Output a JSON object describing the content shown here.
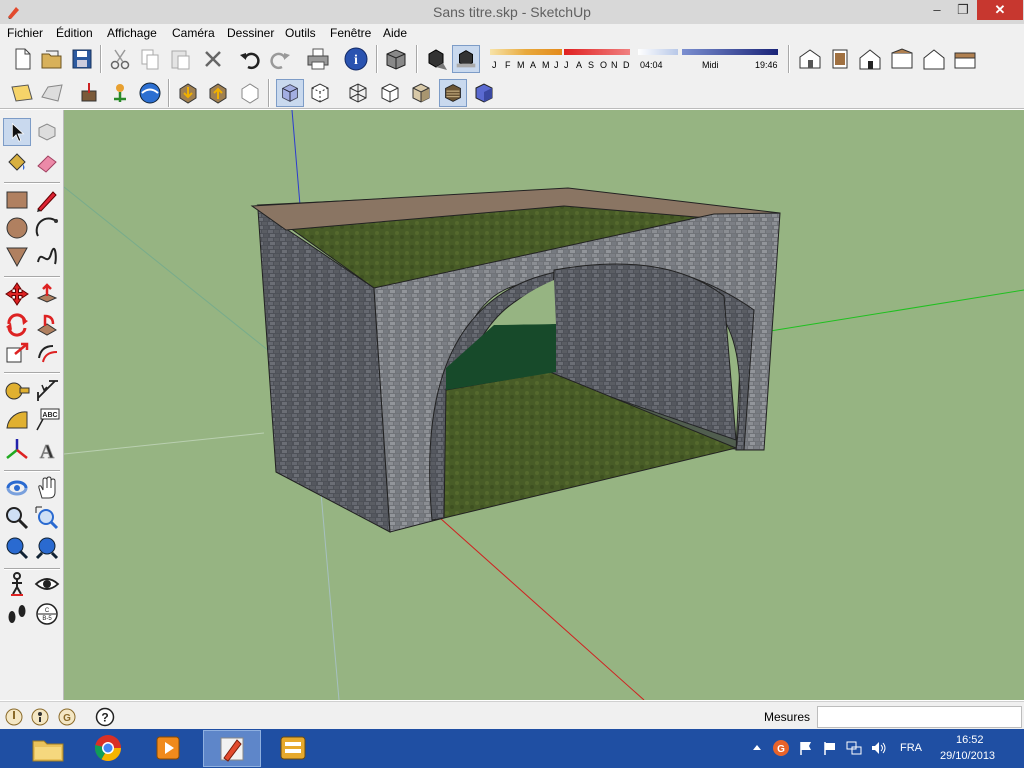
{
  "window": {
    "title": "Sans titre.skp - SketchUp",
    "minimize": "‒",
    "maximize": "❐",
    "close": "✕"
  },
  "menu": [
    "Fichier",
    "Édition",
    "Affichage",
    "Caméra",
    "Dessiner",
    "Outils",
    "Fenêtre",
    "Aide"
  ],
  "shadows": {
    "months": [
      "J",
      "F",
      "M",
      "A",
      "M",
      "J",
      "J",
      "A",
      "S",
      "O",
      "N",
      "D"
    ],
    "time_start": "04:04",
    "time_mid": "Midi",
    "time_end": "19:46"
  },
  "statusbar": {
    "measurements_label": "Mesures",
    "measurements_value": ""
  },
  "tray": {
    "language": "FRA",
    "time": "16:52",
    "date": "29/10/2013"
  },
  "colors": {
    "sky_ground": "#96b482",
    "taskbar": "#1f4fa3",
    "close_button": "#c7372f"
  }
}
